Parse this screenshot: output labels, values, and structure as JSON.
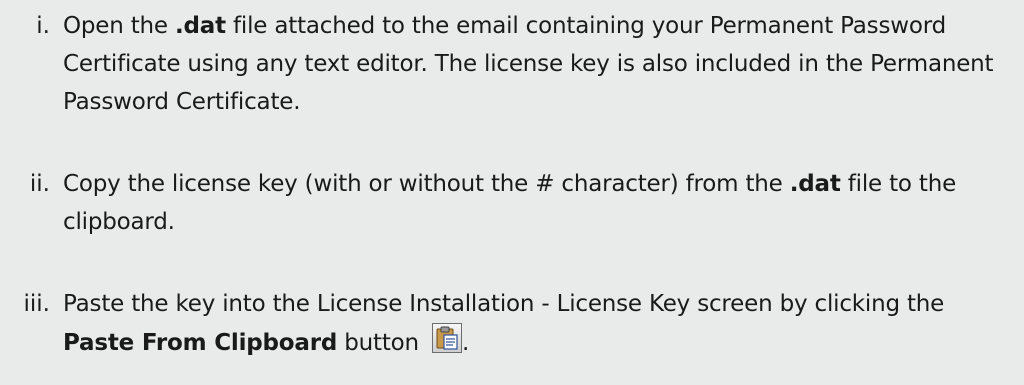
{
  "steps": [
    {
      "marker": "i.",
      "text_a": "Open the ",
      "bold_a": ".dat",
      "text_b": " file attached to the email containing your Permanent Password Certificate using any text editor. The license key is also included in the Permanent Password Certificate."
    },
    {
      "marker": "ii.",
      "text_a": "Copy the license key (with or without the # character) from the ",
      "bold_a": ".dat",
      "text_b": " file to the clipboard."
    },
    {
      "marker": "iii.",
      "text_a": "Paste the key into the License Installation - License Key screen by clicking the ",
      "bold_a": "Paste From Clipboard",
      "text_b": " button ",
      "icon": "paste-from-clipboard-icon",
      "text_c": "."
    }
  ]
}
